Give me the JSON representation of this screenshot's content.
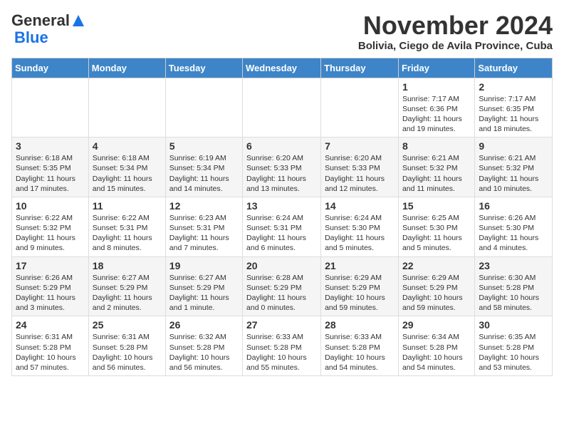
{
  "header": {
    "logo_general": "General",
    "logo_blue": "Blue",
    "month_title": "November 2024",
    "subtitle": "Bolivia, Ciego de Avila Province, Cuba"
  },
  "days_of_week": [
    "Sunday",
    "Monday",
    "Tuesday",
    "Wednesday",
    "Thursday",
    "Friday",
    "Saturday"
  ],
  "weeks": [
    [
      {
        "day": "",
        "info": ""
      },
      {
        "day": "",
        "info": ""
      },
      {
        "day": "",
        "info": ""
      },
      {
        "day": "",
        "info": ""
      },
      {
        "day": "",
        "info": ""
      },
      {
        "day": "1",
        "info": "Sunrise: 7:17 AM\nSunset: 6:36 PM\nDaylight: 11 hours and 19 minutes."
      },
      {
        "day": "2",
        "info": "Sunrise: 7:17 AM\nSunset: 6:35 PM\nDaylight: 11 hours and 18 minutes."
      }
    ],
    [
      {
        "day": "3",
        "info": "Sunrise: 6:18 AM\nSunset: 5:35 PM\nDaylight: 11 hours and 17 minutes."
      },
      {
        "day": "4",
        "info": "Sunrise: 6:18 AM\nSunset: 5:34 PM\nDaylight: 11 hours and 15 minutes."
      },
      {
        "day": "5",
        "info": "Sunrise: 6:19 AM\nSunset: 5:34 PM\nDaylight: 11 hours and 14 minutes."
      },
      {
        "day": "6",
        "info": "Sunrise: 6:20 AM\nSunset: 5:33 PM\nDaylight: 11 hours and 13 minutes."
      },
      {
        "day": "7",
        "info": "Sunrise: 6:20 AM\nSunset: 5:33 PM\nDaylight: 11 hours and 12 minutes."
      },
      {
        "day": "8",
        "info": "Sunrise: 6:21 AM\nSunset: 5:32 PM\nDaylight: 11 hours and 11 minutes."
      },
      {
        "day": "9",
        "info": "Sunrise: 6:21 AM\nSunset: 5:32 PM\nDaylight: 11 hours and 10 minutes."
      }
    ],
    [
      {
        "day": "10",
        "info": "Sunrise: 6:22 AM\nSunset: 5:32 PM\nDaylight: 11 hours and 9 minutes."
      },
      {
        "day": "11",
        "info": "Sunrise: 6:22 AM\nSunset: 5:31 PM\nDaylight: 11 hours and 8 minutes."
      },
      {
        "day": "12",
        "info": "Sunrise: 6:23 AM\nSunset: 5:31 PM\nDaylight: 11 hours and 7 minutes."
      },
      {
        "day": "13",
        "info": "Sunrise: 6:24 AM\nSunset: 5:31 PM\nDaylight: 11 hours and 6 minutes."
      },
      {
        "day": "14",
        "info": "Sunrise: 6:24 AM\nSunset: 5:30 PM\nDaylight: 11 hours and 5 minutes."
      },
      {
        "day": "15",
        "info": "Sunrise: 6:25 AM\nSunset: 5:30 PM\nDaylight: 11 hours and 5 minutes."
      },
      {
        "day": "16",
        "info": "Sunrise: 6:26 AM\nSunset: 5:30 PM\nDaylight: 11 hours and 4 minutes."
      }
    ],
    [
      {
        "day": "17",
        "info": "Sunrise: 6:26 AM\nSunset: 5:29 PM\nDaylight: 11 hours and 3 minutes."
      },
      {
        "day": "18",
        "info": "Sunrise: 6:27 AM\nSunset: 5:29 PM\nDaylight: 11 hours and 2 minutes."
      },
      {
        "day": "19",
        "info": "Sunrise: 6:27 AM\nSunset: 5:29 PM\nDaylight: 11 hours and 1 minute."
      },
      {
        "day": "20",
        "info": "Sunrise: 6:28 AM\nSunset: 5:29 PM\nDaylight: 11 hours and 0 minutes."
      },
      {
        "day": "21",
        "info": "Sunrise: 6:29 AM\nSunset: 5:29 PM\nDaylight: 10 hours and 59 minutes."
      },
      {
        "day": "22",
        "info": "Sunrise: 6:29 AM\nSunset: 5:29 PM\nDaylight: 10 hours and 59 minutes."
      },
      {
        "day": "23",
        "info": "Sunrise: 6:30 AM\nSunset: 5:28 PM\nDaylight: 10 hours and 58 minutes."
      }
    ],
    [
      {
        "day": "24",
        "info": "Sunrise: 6:31 AM\nSunset: 5:28 PM\nDaylight: 10 hours and 57 minutes."
      },
      {
        "day": "25",
        "info": "Sunrise: 6:31 AM\nSunset: 5:28 PM\nDaylight: 10 hours and 56 minutes."
      },
      {
        "day": "26",
        "info": "Sunrise: 6:32 AM\nSunset: 5:28 PM\nDaylight: 10 hours and 56 minutes."
      },
      {
        "day": "27",
        "info": "Sunrise: 6:33 AM\nSunset: 5:28 PM\nDaylight: 10 hours and 55 minutes."
      },
      {
        "day": "28",
        "info": "Sunrise: 6:33 AM\nSunset: 5:28 PM\nDaylight: 10 hours and 54 minutes."
      },
      {
        "day": "29",
        "info": "Sunrise: 6:34 AM\nSunset: 5:28 PM\nDaylight: 10 hours and 54 minutes."
      },
      {
        "day": "30",
        "info": "Sunrise: 6:35 AM\nSunset: 5:28 PM\nDaylight: 10 hours and 53 minutes."
      }
    ]
  ]
}
